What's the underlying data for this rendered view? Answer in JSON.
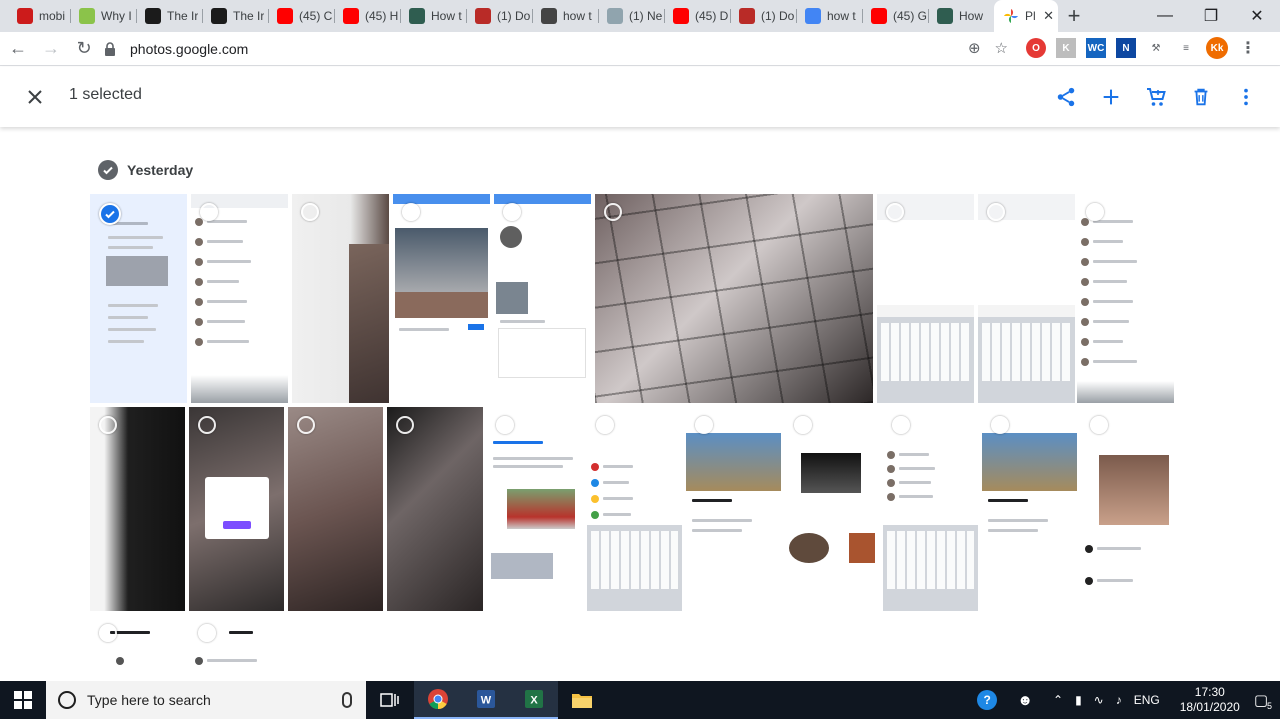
{
  "browser": {
    "tabs": [
      {
        "title": "mobi",
        "favicon": "opera-icon",
        "color": "#cc1b1b"
      },
      {
        "title": "Why I",
        "favicon": "settings-flower-icon",
        "color": "#8bc34a"
      },
      {
        "title": "The Ir",
        "favicon": "movie-icon",
        "color": "#1b1b1b"
      },
      {
        "title": "The Ir",
        "favicon": "movie-icon",
        "color": "#1b1b1b"
      },
      {
        "title": "(45) C",
        "favicon": "youtube-icon",
        "color": "#ff0000"
      },
      {
        "title": "(45) H",
        "favicon": "youtube-icon",
        "color": "#ff0000"
      },
      {
        "title": "How t",
        "favicon": "page-icon",
        "color": "#2f5d50"
      },
      {
        "title": "(1) Do",
        "favicon": "quora-icon",
        "color": "#b92b27"
      },
      {
        "title": "how t",
        "favicon": "page-icon",
        "color": "#444"
      },
      {
        "title": "(1) Ne",
        "favicon": "cloud-icon",
        "color": "#90a4ae"
      },
      {
        "title": "(45) D",
        "favicon": "youtube-icon",
        "color": "#ff0000"
      },
      {
        "title": "(1) Do",
        "favicon": "quora-icon",
        "color": "#b92b27"
      },
      {
        "title": "how t",
        "favicon": "google-icon",
        "color": "#4285f4"
      },
      {
        "title": "(45) G",
        "favicon": "youtube-icon",
        "color": "#ff0000"
      },
      {
        "title": "How",
        "favicon": "page-icon",
        "color": "#2f5d50"
      }
    ],
    "active_tab": {
      "title": "Pl",
      "favicon": "google-photos-icon",
      "close": "✕"
    },
    "new_tab": "+",
    "url": "photos.google.com",
    "profile_initials": "Kk"
  },
  "selection_bar": {
    "count_label": "1 selected",
    "accent": "#1a73e8"
  },
  "grid": {
    "day_label": "Yesterday",
    "selected_index": 0
  },
  "taskbar": {
    "search_placeholder": "Type here to search",
    "language": "ENG",
    "time": "17:30",
    "date": "18/01/2020",
    "notifications": "5"
  }
}
